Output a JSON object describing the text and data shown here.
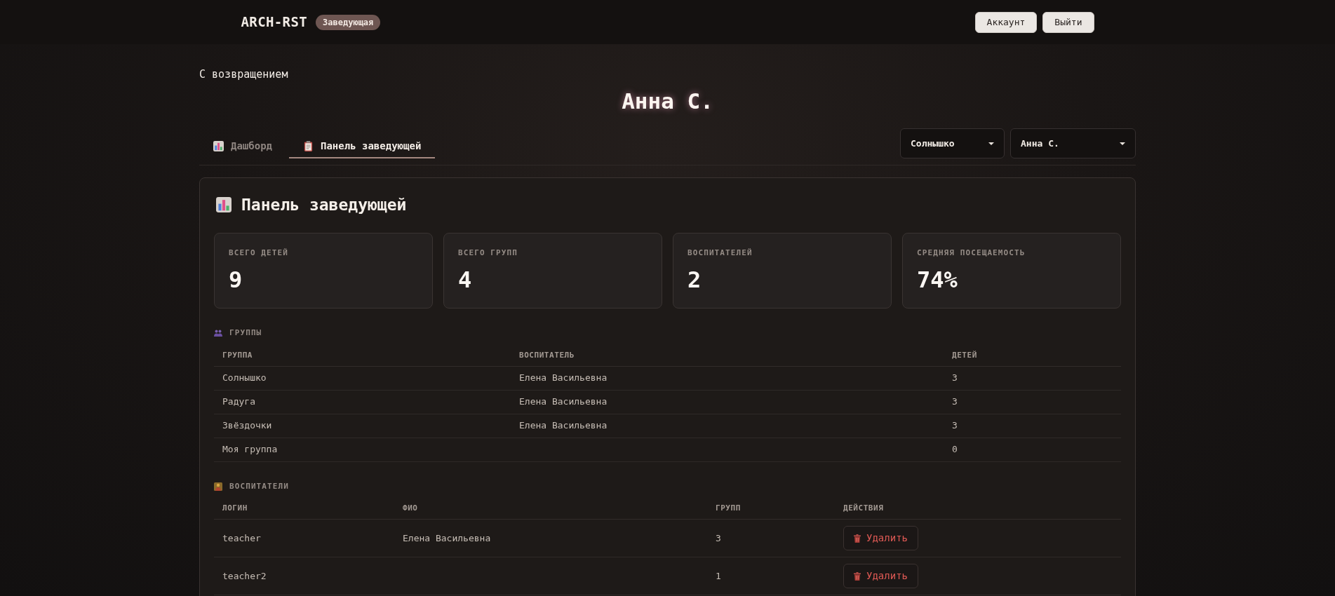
{
  "header": {
    "logo": "ARCH-RST",
    "role_badge": "Заведующая",
    "buttons": [
      "Аккаунт",
      "Выйти"
    ]
  },
  "welcome": {
    "greeting": "С возвращением",
    "name": "Анна С."
  },
  "tabs": [
    {
      "label": "Дашборд",
      "selected": false
    },
    {
      "label": "Панель заведующей",
      "selected": true
    }
  ],
  "filters": [
    {
      "value": "Солнышко"
    },
    {
      "value": "Анна С."
    }
  ],
  "panel": {
    "title": "Панель заведующей",
    "stats": [
      {
        "label": "ВСЕГО ДЕТЕЙ",
        "value": "9"
      },
      {
        "label": "ВСЕГО ГРУПП",
        "value": "4"
      },
      {
        "label": "ВОСПИТАТЕЛЕЙ",
        "value": "2"
      },
      {
        "label": "СРЕДНЯЯ ПОСЕЩАЕМОСТЬ",
        "value": "74%"
      }
    ],
    "groups": {
      "title": "ГРУППЫ",
      "columns": [
        "ГРУППА",
        "ВОСПИТАТЕЛЬ",
        "ДЕТЕЙ"
      ],
      "rows": [
        {
          "group": "Солнышко",
          "teacher": "Елена Васильевна",
          "children_count": "3"
        },
        {
          "group": "Радуга",
          "teacher": "Елена Васильевна",
          "children_count": "3"
        },
        {
          "group": "Звёздочки",
          "teacher": "Елена Васильевна",
          "children_count": "3"
        },
        {
          "group": "Моя группа",
          "children_count": "0"
        }
      ]
    },
    "teachers": {
      "title": "ВОСПИТАТЕЛИ",
      "columns": [
        "ЛОГИН",
        "ФИО",
        "ГРУПП",
        "ДЕЙСТВИЯ"
      ],
      "rows": [
        {
          "login": "teacher",
          "full_name": "Елена Васильевна",
          "group_count": "3",
          "action": "Удалить"
        },
        {
          "login": "teacher2",
          "group_count": "1",
          "action": "Удалить"
        }
      ]
    }
  }
}
